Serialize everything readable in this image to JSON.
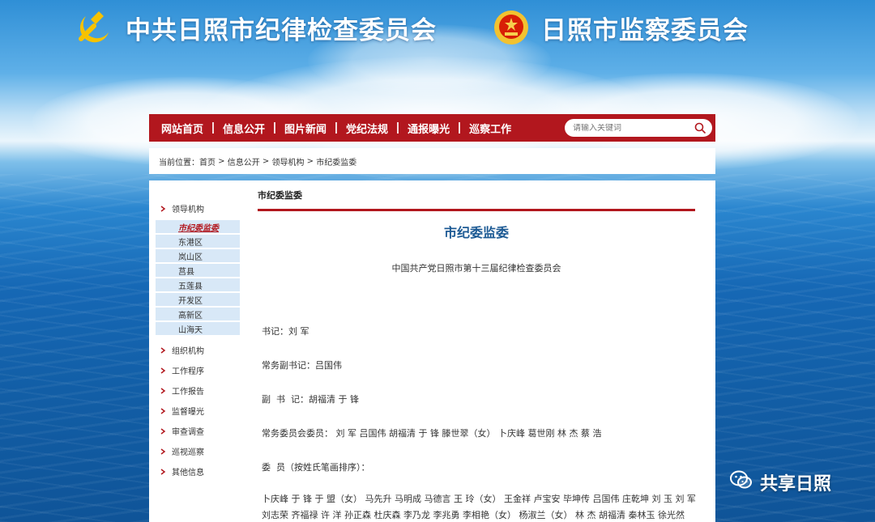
{
  "header": {
    "left_org": "中共日照市纪律检查委员会",
    "right_org": "日照市监察委员会"
  },
  "nav": {
    "items": [
      "网站首页",
      "信息公开",
      "图片新闻",
      "党纪法规",
      "通报曝光",
      "巡察工作"
    ],
    "search_placeholder": "请输入关键词"
  },
  "breadcrumb": {
    "prefix": "当前位置：",
    "items": [
      "首页",
      "信息公开",
      "领导机构",
      "市纪委监委"
    ],
    "separator": " > "
  },
  "sidebar": {
    "top": "领导机构",
    "subitems": [
      "市纪委监委",
      "东港区",
      "岚山区",
      "莒县",
      "五莲县",
      "开发区",
      "高新区",
      "山海天"
    ],
    "active_index": 0,
    "items": [
      "组织机构",
      "工作程序",
      "工作报告",
      "监督曝光",
      "审查调查",
      "巡视巡察",
      "其他信息"
    ]
  },
  "main": {
    "section_title": "市纪委监委",
    "title": "市纪委监委",
    "subtitle": "中国共产党日照市第十三届纪律检查委员会",
    "secretary": "书记：刘 军",
    "exec_deputy": "常务副书记：吕国伟",
    "deputies": "副  书  记：胡福清 于 锋",
    "standing": "常务委员会委员： 刘 军 吕国伟 胡福清 于 锋 滕世翠（女） 卜庆峰 葛世刚 林 杰 蔡 浩",
    "members_label": "委  员（按姓氏笔画排序）：",
    "members_text": "卜庆峰 于 锋 于 盟（女） 马先升 马明成 马德言 王 玲（女） 王金祥 卢宝安 毕坤传 吕国伟 庄乾坤 刘 玉 刘 军 刘志荣 齐福禄 许 洋 孙正森 杜庆森 李乃龙 李兆勇 李相艳（女） 杨淑兰（女） 林 杰 胡福清 秦林玉 徐光然 郭 莉（女） 葛世刚 董书超 惠希建 惠希胜 熊桂登 滕世翠（女） 薛慧敏（女）"
  },
  "watermark": {
    "text": "共享日照",
    "icon": "wechat-icon"
  },
  "colors": {
    "nav_red": "#b2171e",
    "title_blue": "#1c5a94",
    "sidebar_sub_bg": "#d8e8f7"
  }
}
